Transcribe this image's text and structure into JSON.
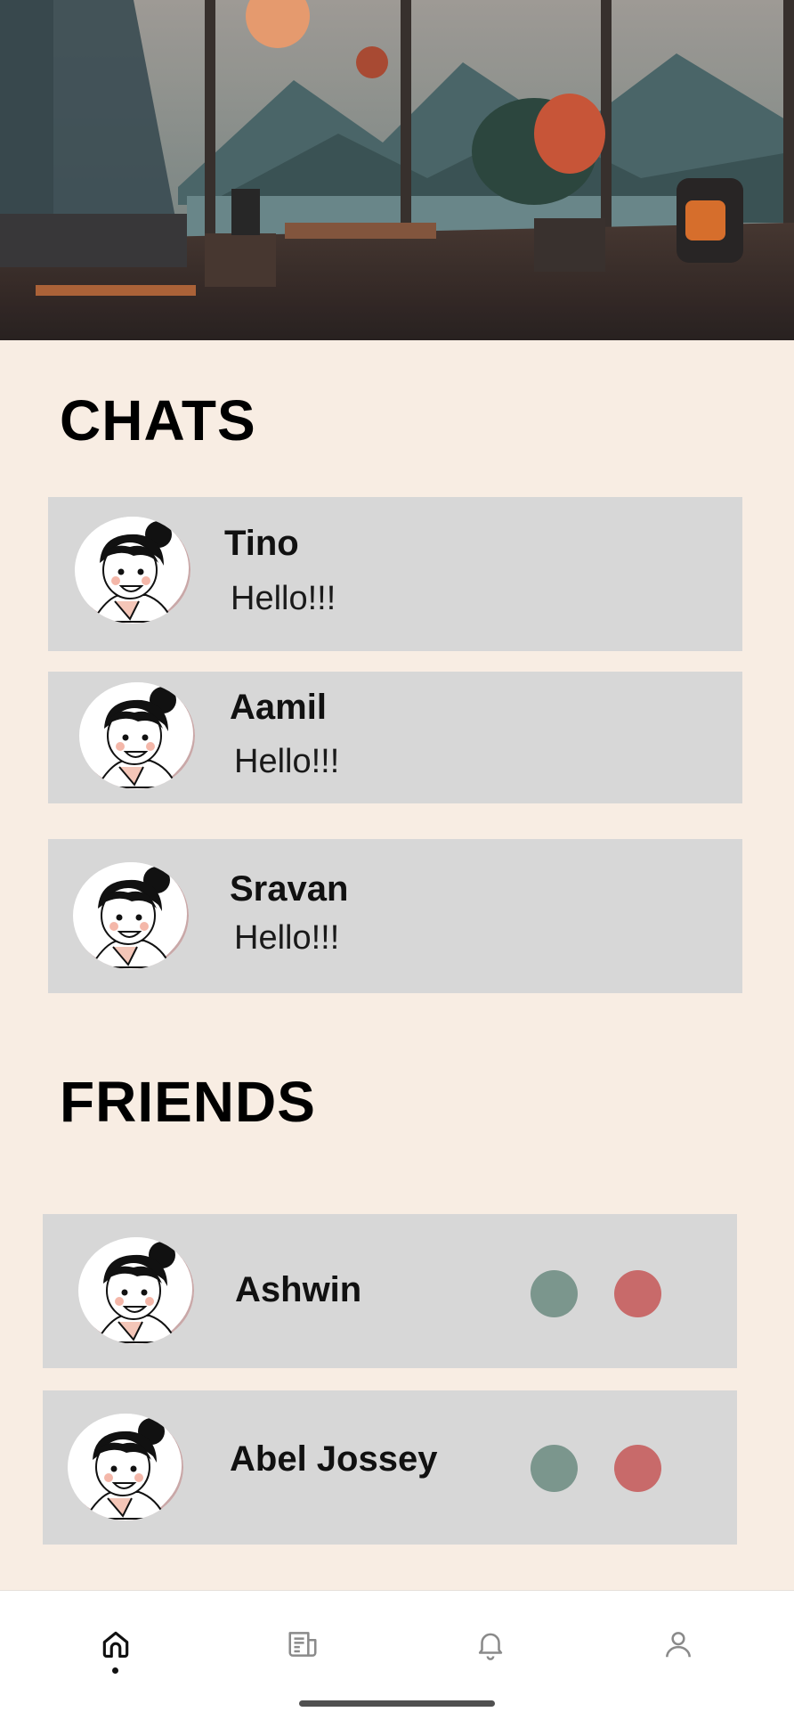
{
  "chats_section": {
    "title": "CHATS",
    "items": [
      {
        "name": "Tino",
        "message": "Hello!!!"
      },
      {
        "name": "Aamil",
        "message": "Hello!!!"
      },
      {
        "name": "Sravan",
        "message": "Hello!!!"
      }
    ]
  },
  "friends_section": {
    "title": "FRIENDS",
    "items": [
      {
        "name": "Ashwin",
        "accept_color": "#7b968d",
        "reject_color": "#c86a6a"
      },
      {
        "name": "Abel Jossey",
        "accept_color": "#7b968d",
        "reject_color": "#c86a6a"
      }
    ]
  },
  "bottom_nav": {
    "items": [
      {
        "icon": "home-icon",
        "active": true
      },
      {
        "icon": "news-icon",
        "active": false
      },
      {
        "icon": "bell-icon",
        "active": false
      },
      {
        "icon": "profile-icon",
        "active": false
      }
    ]
  },
  "colors": {
    "background": "#f8ede3",
    "card": "#d7d7d7",
    "accept": "#7b968d",
    "reject": "#c86a6a"
  }
}
